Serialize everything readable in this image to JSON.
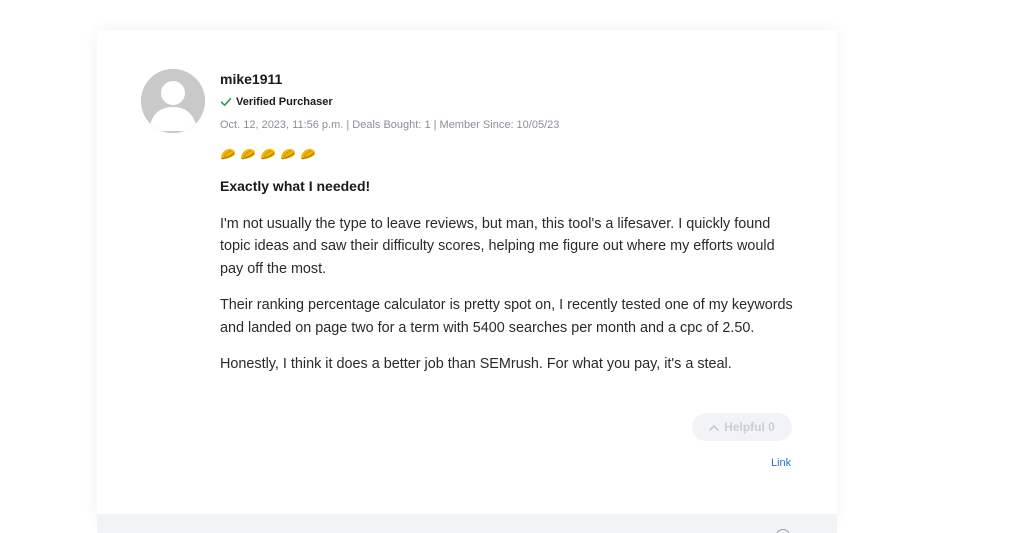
{
  "review": {
    "username": "mike1911",
    "verified_label": "Verified Purchaser",
    "meta": "Oct. 12, 2023, 11:56 p.m. | Deals Bought: 1 | Member Since: 10/05/23",
    "rating": 5,
    "rating_icon": "taco-icon",
    "title": "Exactly what I needed!",
    "paragraphs": [
      "I'm not usually the type to leave reviews, but man, this tool's a lifesaver. I quickly found topic ideas and saw their difficulty scores, helping me figure out where my efforts would pay off the most.",
      "Their ranking percentage calculator is pretty spot on, I recently tested one of my keywords and landed on page two for a term with 5400 searches per month and a cpc of 2.50.",
      "Honestly, I think it does a better job than SEMrush. For what you pay, it's a steal."
    ],
    "helpful_label": "Helpful 0",
    "link_label": "Link"
  },
  "colors": {
    "accent_link": "#2b6fd1",
    "verified_check": "#1fa05a",
    "taco": "#f0b400",
    "meta_text": "#8a8f99"
  }
}
